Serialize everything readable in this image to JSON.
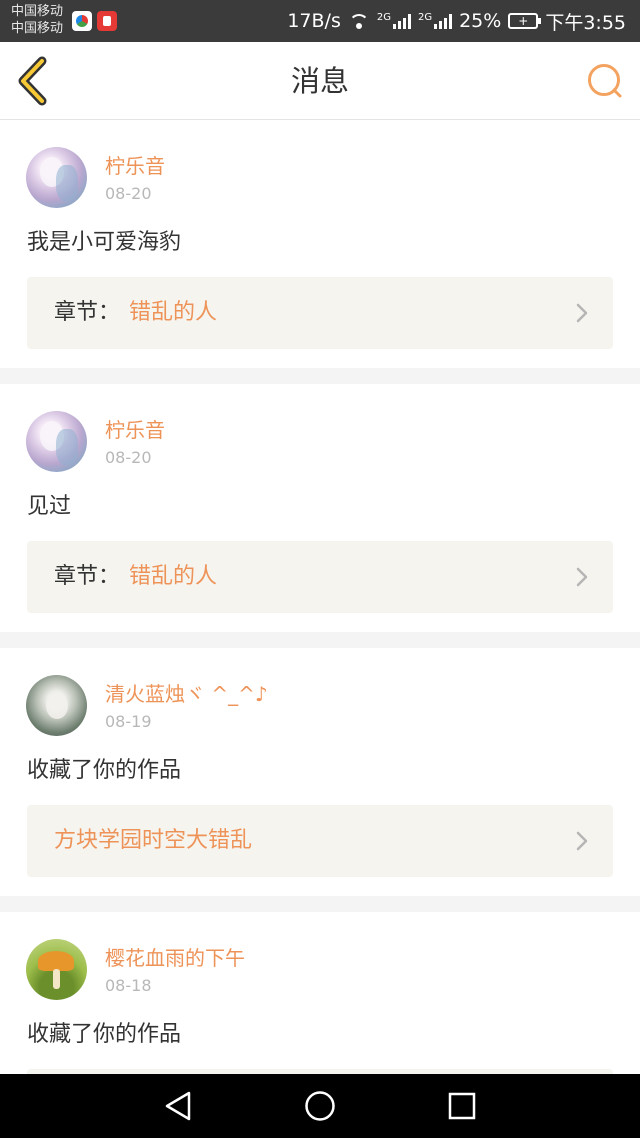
{
  "status_bar": {
    "carrier_1": "中国移动",
    "carrier_2": "中国移动",
    "net_speed": "17B/s",
    "network_1": "2G",
    "network_2": "2G",
    "battery_percent": "25%",
    "time": "下午3:55"
  },
  "header": {
    "title": "消息",
    "back_icon": "chevron-left-icon",
    "search_icon": "search-icon",
    "accent_color": "#f3a35f"
  },
  "messages": [
    {
      "username": "柠乐音",
      "date": "08-20",
      "text": "我是小可爱海豹",
      "chapter_label": "章节：",
      "chapter_title": "错乱的人"
    },
    {
      "username": "柠乐音",
      "date": "08-20",
      "text": "见过",
      "chapter_label": "章节：",
      "chapter_title": "错乱的人"
    },
    {
      "username": "清火蓝烛ヾ ^_^♪",
      "date": "08-19",
      "text": "收藏了你的作品",
      "work_title": "方块学园时空大错乱"
    },
    {
      "username": "樱花血雨的下午",
      "date": "08-18",
      "text": "收藏了你的作品"
    }
  ],
  "nav_bar": {
    "icons": [
      "back-triangle-icon",
      "home-circle-icon",
      "recent-square-icon"
    ]
  }
}
